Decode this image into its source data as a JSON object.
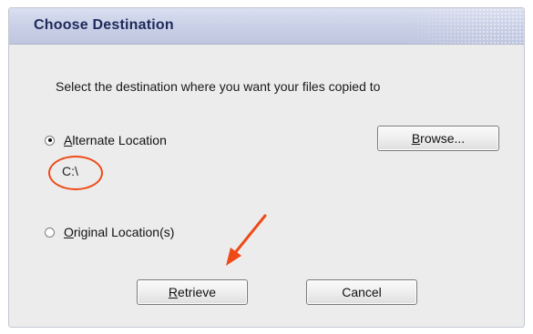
{
  "dialog": {
    "title": "Choose Destination",
    "instruction": "Select the destination where you want your files copied to",
    "options": [
      {
        "label_prefix": "",
        "mnemonic": "A",
        "label_rest": "lternate Location",
        "selected": true
      },
      {
        "label_prefix": "",
        "mnemonic": "O",
        "label_rest": "riginal Location(s)",
        "selected": false
      }
    ],
    "selected_path": "C:\\",
    "buttons": {
      "browse_mnemonic": "B",
      "browse_rest": "rowse...",
      "retrieve_mnemonic": "R",
      "retrieve_rest": "etrieve",
      "cancel_label": "Cancel"
    }
  },
  "annotation": {
    "color": "#ee4a17"
  }
}
